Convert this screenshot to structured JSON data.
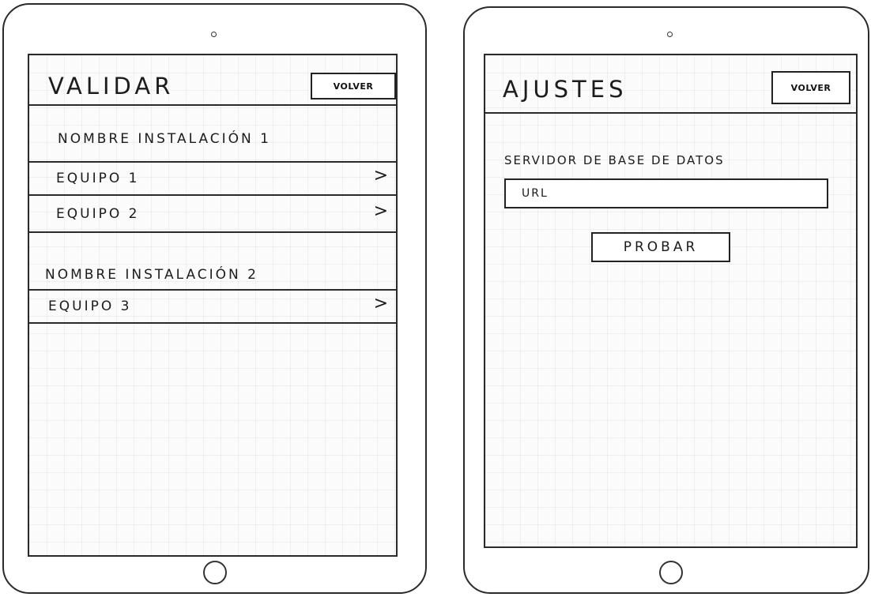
{
  "validar_screen": {
    "title": "Validar",
    "back_label": "Volver",
    "installations": [
      {
        "name": "Nombre instalación 1",
        "equipment": [
          {
            "label": "Equipo 1",
            "chevron": ">"
          },
          {
            "label": "Equipo 2",
            "chevron": ">"
          }
        ]
      },
      {
        "name": "Nombre instalación 2",
        "equipment": [
          {
            "label": "Equipo 3",
            "chevron": ">"
          }
        ]
      }
    ]
  },
  "ajustes_screen": {
    "title": "Ajustes",
    "back_label": "Volver",
    "section_label": "Servidor de base de datos",
    "url_field": {
      "placeholder": "URL"
    },
    "test_button_label": "Probar"
  }
}
